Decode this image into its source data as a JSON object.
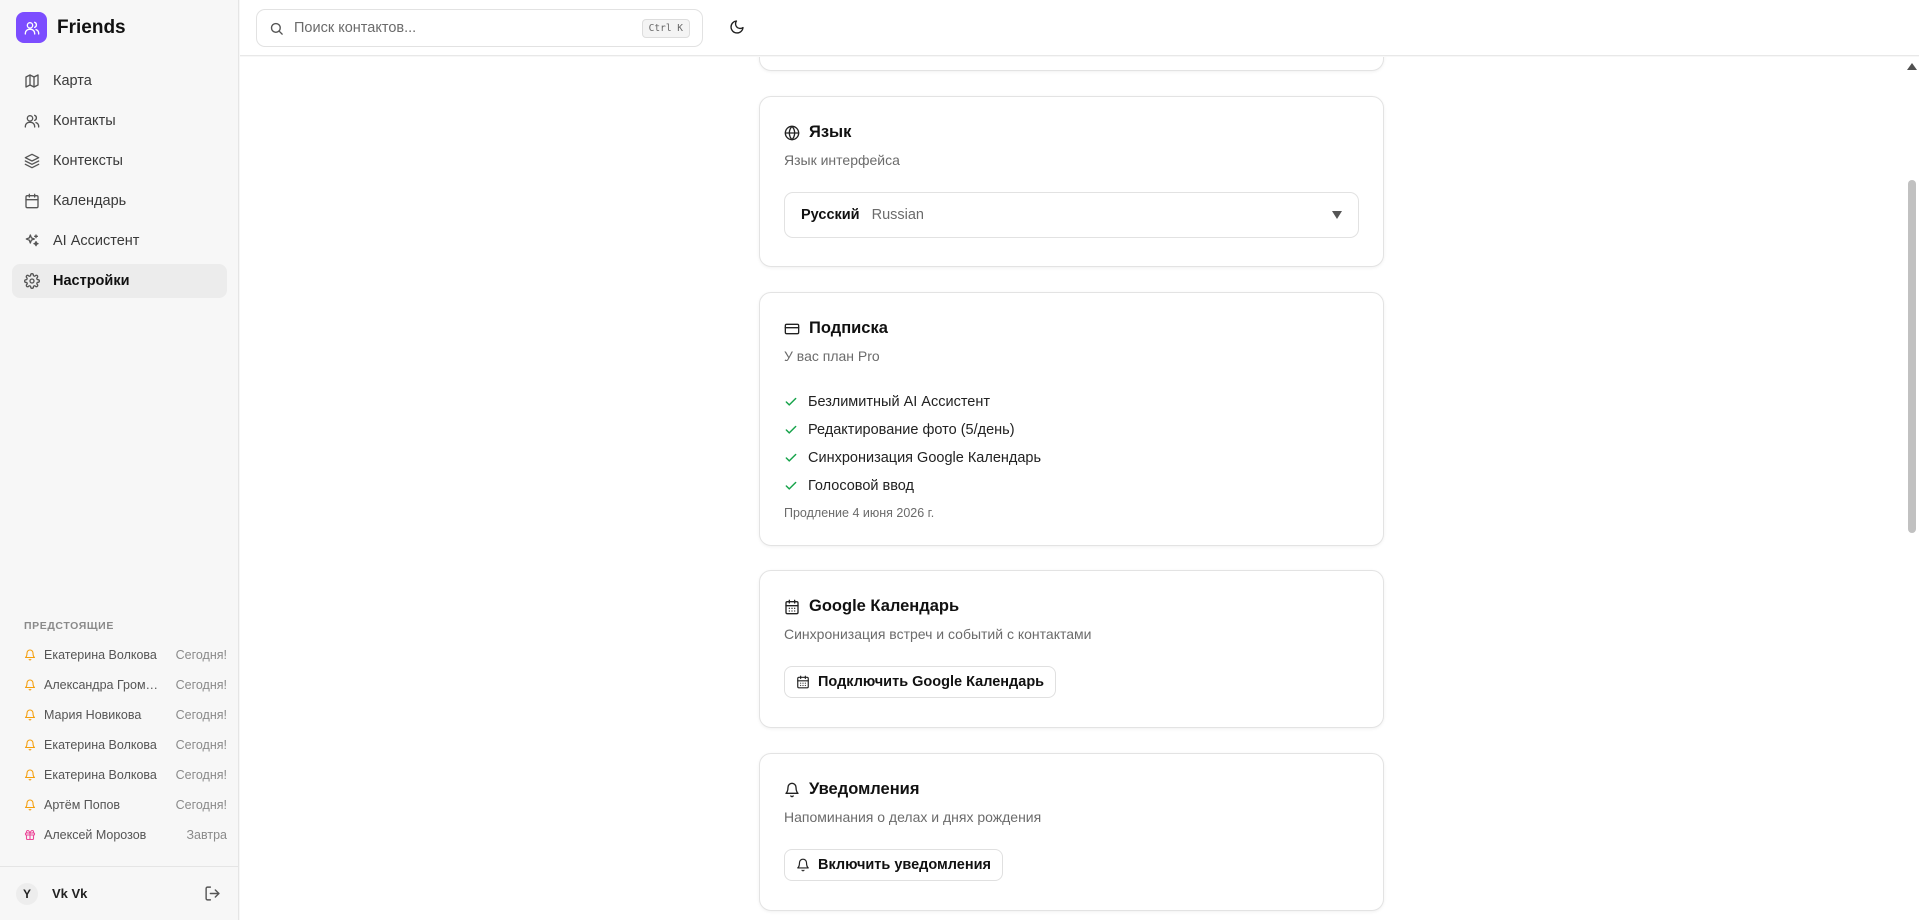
{
  "app": {
    "name": "Friends"
  },
  "nav": {
    "items": [
      {
        "label": "Карта",
        "icon": "map-icon"
      },
      {
        "label": "Контакты",
        "icon": "users-icon"
      },
      {
        "label": "Контексты",
        "icon": "layers-icon"
      },
      {
        "label": "Календарь",
        "icon": "calendar-icon"
      },
      {
        "label": "AI Ассистент",
        "icon": "sparkles-icon"
      },
      {
        "label": "Настройки",
        "icon": "gear-icon",
        "active": true
      }
    ]
  },
  "upcoming": {
    "title": "ПРЕДСТОЯЩИЕ",
    "items": [
      {
        "name": "Екатерина Волкова",
        "when": "Сегодня!",
        "icon": "bell-icon"
      },
      {
        "name": "Александра Громова",
        "when": "Сегодня!",
        "icon": "bell-icon"
      },
      {
        "name": "Мария Новикова",
        "when": "Сегодня!",
        "icon": "bell-icon"
      },
      {
        "name": "Екатерина Волкова",
        "when": "Сегодня!",
        "icon": "bell-icon"
      },
      {
        "name": "Екатерина Волкова",
        "when": "Сегодня!",
        "icon": "bell-icon"
      },
      {
        "name": "Артём Попов",
        "when": "Сегодня!",
        "icon": "bell-icon"
      },
      {
        "name": "Алексей Морозов",
        "when": "Завтра",
        "icon": "gift-icon"
      }
    ]
  },
  "user": {
    "initial": "Y",
    "name": "Vk Vk"
  },
  "header": {
    "search_placeholder": "Поиск контактов...",
    "shortcut": "Ctrl K"
  },
  "settings": {
    "language": {
      "title": "Язык",
      "subtitle": "Язык интерфейса",
      "selected_native": "Русский",
      "selected_english": "Russian"
    },
    "subscription": {
      "title": "Подписка",
      "subtitle": "У вас план Pro",
      "features": [
        "Безлимитный AI Ассистент",
        "Редактирование фото (5/день)",
        "Синхронизация Google Календарь",
        "Голосовой ввод"
      ],
      "renewal": "Продление 4 июня 2026 г."
    },
    "google_calendar": {
      "title": "Google Календарь",
      "subtitle": "Синхронизация встреч и событий с контактами",
      "button": "Подключить Google Календарь"
    },
    "notifications": {
      "title": "Уведомления",
      "subtitle": "Напоминания о делах и днях рождения",
      "button": "Включить уведомления"
    }
  },
  "colors": {
    "brand": "#7c4dff",
    "check": "#16a34a",
    "bell": "#f59e0b",
    "gift": "#ec4899"
  }
}
